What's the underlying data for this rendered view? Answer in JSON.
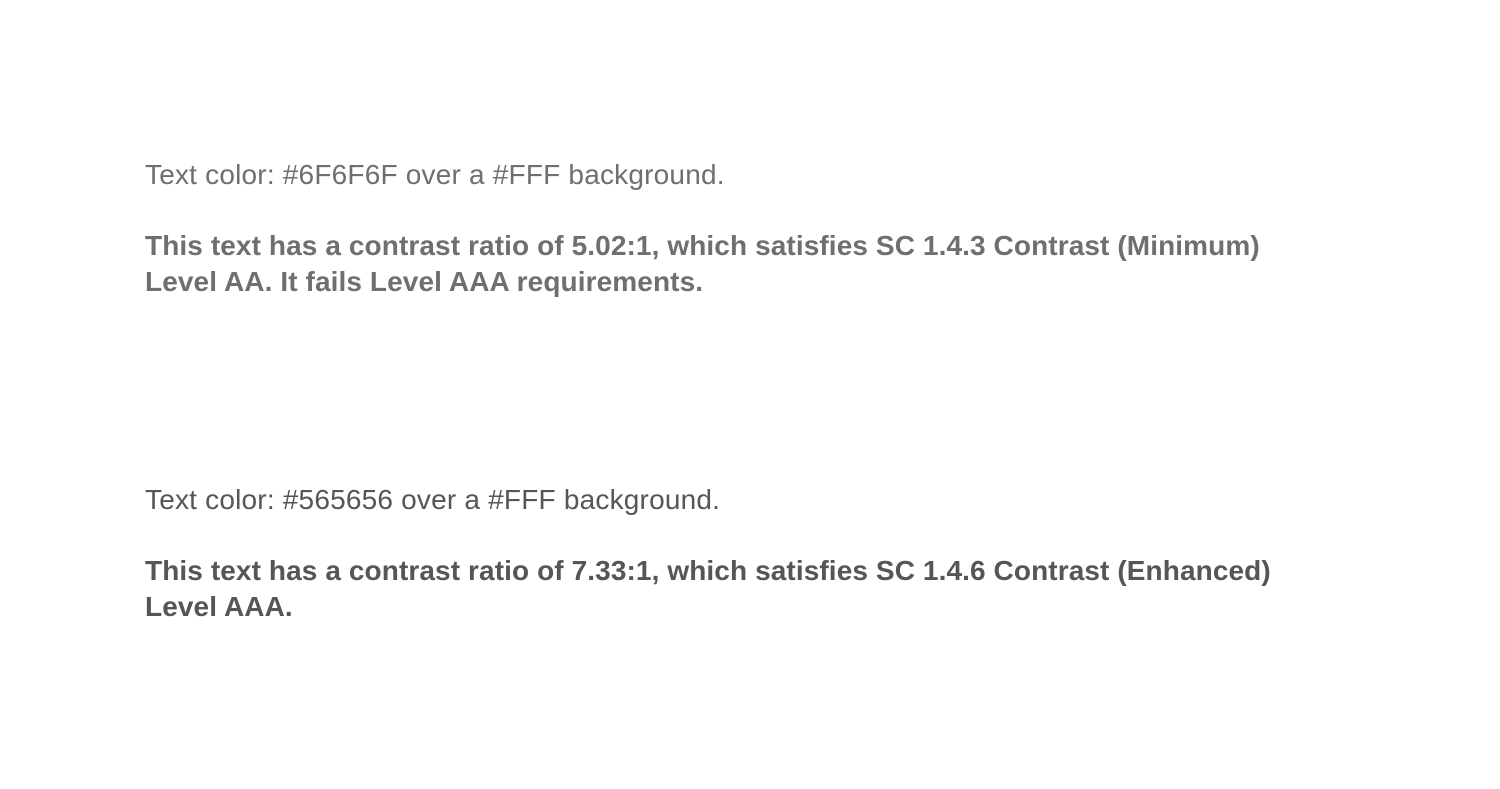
{
  "examples": [
    {
      "text_color": "#6F6F6F",
      "background_color": "#FFFFFF",
      "caption": "Text color: #6F6F6F over a #FFF background.",
      "statement_line_1": "This text has a contrast ratio of 5.02:1, which satisfies SC 1.4.3 Contrast (Minimum)",
      "statement_line_2": "Level AA. It fails Level AAA requirements."
    },
    {
      "text_color": "#565656",
      "background_color": "#FFFFFF",
      "caption": "Text color: #565656 over a #FFF background.",
      "statement_line_1": "This text has a contrast ratio of 7.33:1, which satisfies SC 1.4.6 Contrast (Enhanced)",
      "statement_line_2": "Level AAA."
    }
  ]
}
